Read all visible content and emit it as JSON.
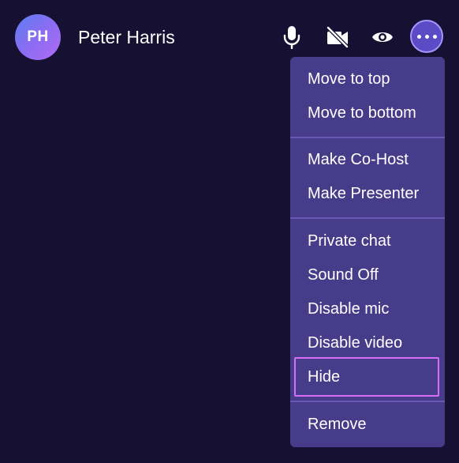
{
  "participant": {
    "initials": "PH",
    "name": "Peter Harris"
  },
  "controls": {
    "mic_icon": "microphone-icon",
    "video_icon": "video-off-icon",
    "eye_icon": "eye-icon",
    "more_icon": "more-horizontal-icon"
  },
  "menu": {
    "groups": [
      {
        "items": [
          "Move to top",
          "Move to bottom"
        ]
      },
      {
        "items": [
          "Make Co-Host",
          "Make Presenter"
        ]
      },
      {
        "items": [
          "Private chat",
          "Sound Off",
          "Disable mic",
          "Disable video",
          "Hide"
        ]
      },
      {
        "items": [
          "Remove"
        ]
      }
    ],
    "focused_item": "Hide"
  },
  "colors": {
    "background": "#161033",
    "menu_background": "#473c8a",
    "focus_outline": "#d86ef5",
    "more_button": "#5b4bc4"
  }
}
